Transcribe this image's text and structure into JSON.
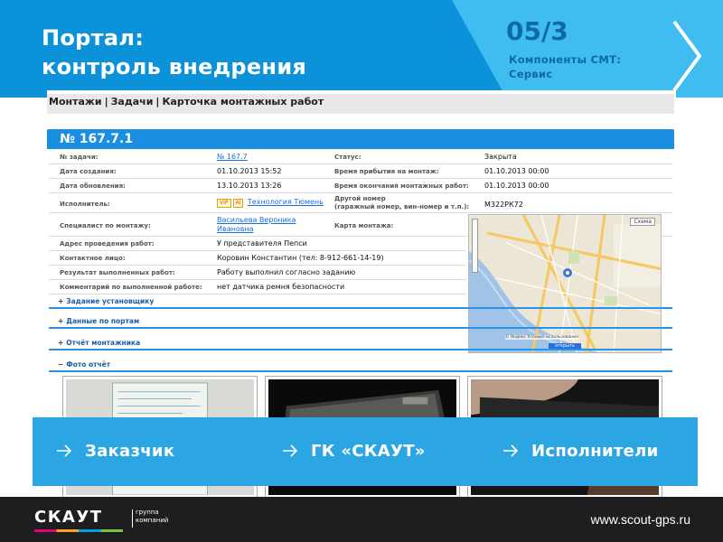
{
  "header": {
    "title_line1": "Портал:",
    "title_line2": "контроль внедрения",
    "slide_number": "05/3",
    "section_line1": "Компоненты СМТ:",
    "section_line2": "Сервис",
    "next_icon": "chevron-right-icon",
    "colors": {
      "band": "#0c92d8",
      "wedge": "#3fbcf0",
      "accent_text": "#0c6aa8"
    }
  },
  "portal": {
    "breadcrumb": [
      "Монтажи",
      "Задачи",
      "Карточка монтажных работ"
    ],
    "breadcrumb_separator": "|",
    "card_title": "№ 167.7.1",
    "fields_left": [
      {
        "label": "№ задачи:",
        "value": "№ 167.7",
        "link": true
      },
      {
        "label": "Дата создания:",
        "value": "01.10.2013 15:52"
      },
      {
        "label": "Дата обновления:",
        "value": "13.10.2013 13:26"
      },
      {
        "label": "Исполнитель:",
        "value": "Технология Тюмень",
        "badges": [
          "VIP",
          "AI"
        ],
        "link": true
      },
      {
        "label": "Специалист по монтажу:",
        "value_line1": "Васильева Вероника",
        "value_line2": "Ивановна",
        "link": true
      },
      {
        "label": "Адрес проведения работ:",
        "value": "У представителя Пепси"
      },
      {
        "label": "Контактное лицо:",
        "value": "Коровин Константин (тел: 8-912-661-14-19)"
      },
      {
        "label": "Результат выполненных работ:",
        "value": "Работу выполнил согласно заданию"
      },
      {
        "label": "Комментарий по выполненной работе:",
        "value": "нет датчика ремня безопасности"
      }
    ],
    "fields_right": [
      {
        "label": "Статус:",
        "value": "Закрыта"
      },
      {
        "label": "Время прибытия на монтаж:",
        "value": "01.10.2013 00:00"
      },
      {
        "label": "Время окончания монтажных работ:",
        "value": "01.10.2013 00:00"
      },
      {
        "label_line1": "Другой номер",
        "label_line2": "(гаражный номер, вин-номер и т.п.):",
        "value": "М322РК72"
      },
      {
        "label": "Карта монтажа:",
        "value": ""
      }
    ],
    "sections": [
      {
        "sign": "+",
        "label": "Задание установщику"
      },
      {
        "sign": "+",
        "label": "Данные по портам"
      },
      {
        "sign": "+",
        "label": "Отчёт монтажника"
      },
      {
        "sign": "−",
        "label": "Фото отчёт"
      }
    ],
    "map": {
      "layer_control": "Схема",
      "button": "открыть",
      "attribution": "© Яндекс   Условия использования"
    },
    "photos": [
      "photo-document",
      "photo-device",
      "photo-hand"
    ]
  },
  "overlay": {
    "links": [
      "Заказчик",
      "ГК «СКАУТ»",
      "Исполнители"
    ],
    "icon": "arrow-right-icon",
    "color": "#2ba6e2"
  },
  "footer": {
    "logo_word": "СКАУТ",
    "logo_sub_line1": "группа",
    "logo_sub_line2": "компаний",
    "url": "www.scout-gps.ru"
  }
}
